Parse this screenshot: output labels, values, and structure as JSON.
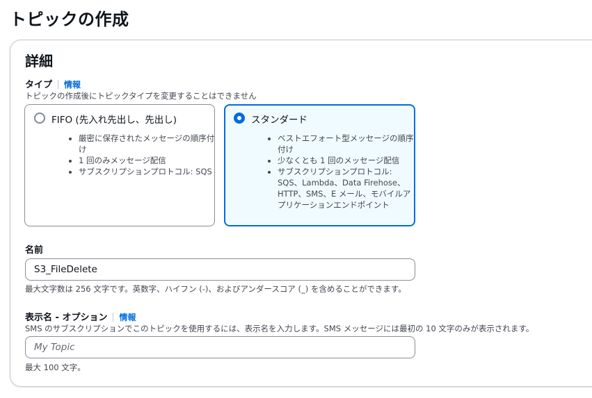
{
  "page": {
    "title": "トピックの作成"
  },
  "panel": {
    "title": "詳細"
  },
  "type_field": {
    "label": "タイプ",
    "info": "情報",
    "description": "トピックの作成後にトピックタイプを変更することはできません",
    "options": [
      {
        "title": "FIFO (先入れ先出し、先出し)",
        "selected": false,
        "bullets": [
          "厳密に保存されたメッセージの順序付け",
          "1 回のみメッセージ配信",
          "サブスクリプションプロトコル: SQS"
        ]
      },
      {
        "title": "スタンダード",
        "selected": true,
        "bullets": [
          "ベストエフォート型メッセージの順序付け",
          "少なくとも 1 回のメッセージ配信",
          "サブスクリプションプロトコル: SQS、Lambda、Data Firehose、HTTP、SMS、E メール、モバイルアプリケーションエンドポイント"
        ]
      }
    ]
  },
  "name_field": {
    "label": "名前",
    "value": "S3_FileDelete",
    "constraint": "最大文字数は 256 文字です。英数字、ハイフン (-)、およびアンダースコア (_) を含めることができます。"
  },
  "display_name_field": {
    "label": "表示名 - オプション",
    "info": "情報",
    "description": "SMS のサブスクリプションでこのトピックを使用するには、表示名を入力します。SMS メッセージには最初の 10 文字のみが表示されます。",
    "placeholder": "My Topic",
    "value": "",
    "constraint": "最大 100 文字。"
  },
  "colors": {
    "accent": "#006ce0",
    "selected_bg": "#f0fbff",
    "border": "#8c8c94"
  }
}
